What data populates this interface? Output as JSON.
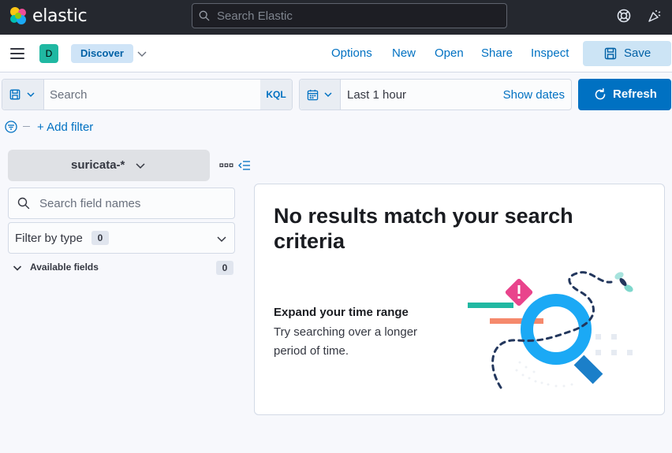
{
  "header": {
    "brand": "elastic",
    "search_placeholder": "Search Elastic",
    "icons": [
      "elastic-logo",
      "help-icon",
      "newsfeed-icon"
    ]
  },
  "appbar": {
    "space_initial": "D",
    "breadcrumb": "Discover",
    "links": [
      "Options",
      "New",
      "Open",
      "Share",
      "Inspect"
    ],
    "save_label": "Save"
  },
  "query": {
    "placeholder": "Search",
    "language": "KQL",
    "time_range": "Last 1 hour",
    "show_dates": "Show dates",
    "refresh_label": "Refresh",
    "add_filter": "+ Add filter"
  },
  "sidebar": {
    "index_pattern": "suricata-*",
    "field_search_placeholder": "Search field names",
    "filter_by_type": "Filter by type",
    "filter_count": "0",
    "available_fields": "Available fields",
    "available_count": "0"
  },
  "main": {
    "title": "No results match your search criteria",
    "subtitle": "Expand your time range",
    "description": "Try searching over a longer period of time."
  },
  "colors": {
    "accent": "#0071c2",
    "header_bg": "#25282f",
    "space_avatar": "#20b8a2"
  }
}
